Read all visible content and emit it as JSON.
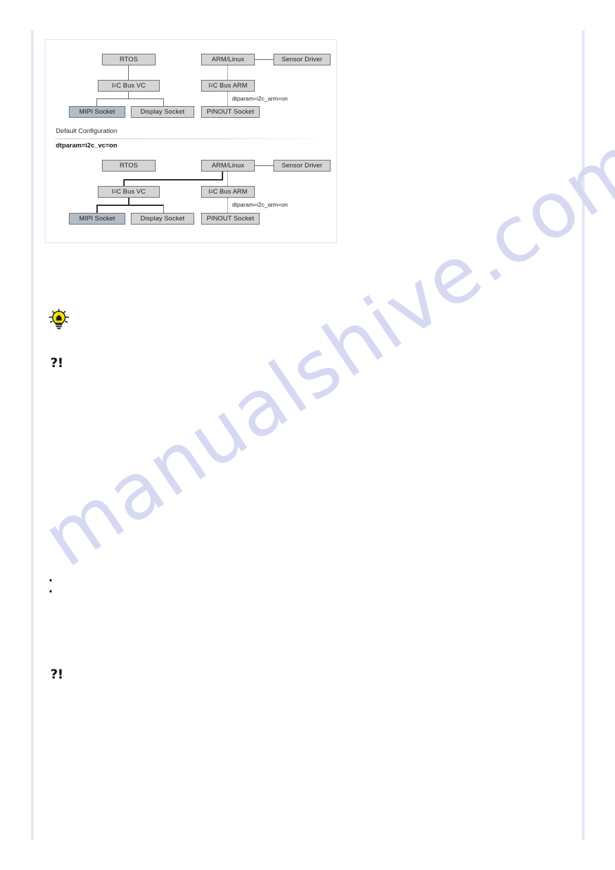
{
  "page": {
    "watermark": "manualshive.com"
  },
  "figure": {
    "caption_label": "Default Configuration",
    "caption_value": "dtparam=i2c_vc=on",
    "diagrams": [
      {
        "name": "default-configuration-diagram",
        "nodes": {
          "rtos": "RTOS",
          "i2c_bus_vc": "I2C Bus VC",
          "i2c_bus_vc_prefix": "I",
          "i2c_bus_vc_sup": "2",
          "i2c_bus_vc_suffix": "C Bus VC",
          "mipi_socket": "MIPI Socket",
          "display_socket": "Display Socket",
          "arm_linux": "ARM/Linux",
          "sensor_driver": "Sensor Driver",
          "i2c_bus_arm_prefix": "I",
          "i2c_bus_arm_sup": "2",
          "i2c_bus_arm_suffix": "C Bus ARM",
          "pinout_socket": "PINOUT Socket"
        },
        "wire_label": "dtparam=i2c_arm=on"
      },
      {
        "name": "alternate-configuration-diagram",
        "nodes": {
          "rtos": "RTOS",
          "i2c_bus_vc_prefix": "I",
          "i2c_bus_vc_sup": "2",
          "i2c_bus_vc_suffix": "C Bus VC",
          "mipi_socket": "MIPI Socket",
          "display_socket": "Display Socket",
          "arm_linux": "ARM/Linux",
          "sensor_driver": "Sensor Driver",
          "i2c_bus_arm_prefix": "I",
          "i2c_bus_arm_sup": "2",
          "i2c_bus_arm_suffix": "C Bus ARM",
          "pinout_socket": "PINOUT Socket"
        },
        "wire_label": "dtparam=i2c_arm=on"
      }
    ]
  },
  "body": {
    "tip_icon": "lightbulb-icon",
    "note_marker_1": "?!",
    "note_marker_2": "?!"
  },
  "colors": {
    "node_fill": "#d4d4d4",
    "node_fill_highlight": "#b4bcc6",
    "node_border": "#6f7278",
    "wire": "#63666c",
    "wire_thick": "#2d2f33",
    "frame_border": "#e2e4ee",
    "margin_rule": "#e4e7f4",
    "watermark": "#d7d9f2",
    "bulb_yellow": "#f5e400"
  }
}
